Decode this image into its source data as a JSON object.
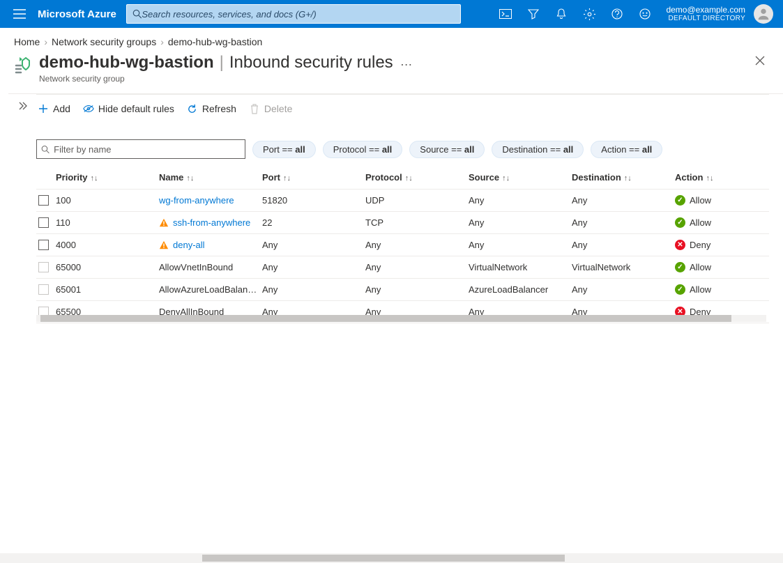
{
  "brand": "Microsoft Azure",
  "search": {
    "placeholder": "Search resources, services, and docs (G+/)"
  },
  "account": {
    "email": "demo@example.com",
    "directory": "DEFAULT DIRECTORY"
  },
  "breadcrumb": {
    "items": [
      {
        "label": "Home"
      },
      {
        "label": "Network security groups"
      },
      {
        "label": "demo-hub-wg-bastion"
      }
    ]
  },
  "page": {
    "resource_name": "demo-hub-wg-bastion",
    "section": "Inbound security rules",
    "subtitle": "Network security group"
  },
  "toolbar": {
    "add": "Add",
    "hide_default": "Hide default rules",
    "refresh": "Refresh",
    "delete": "Delete"
  },
  "filter": {
    "name_placeholder": "Filter by name",
    "pills": [
      {
        "prefix": "Port == ",
        "val": "all"
      },
      {
        "prefix": "Protocol == ",
        "val": "all"
      },
      {
        "prefix": "Source == ",
        "val": "all"
      },
      {
        "prefix": "Destination == ",
        "val": "all"
      },
      {
        "prefix": "Action == ",
        "val": "all"
      }
    ]
  },
  "columns": {
    "priority": "Priority",
    "name": "Name",
    "port": "Port",
    "protocol": "Protocol",
    "source": "Source",
    "destination": "Destination",
    "action": "Action"
  },
  "rows": [
    {
      "priority": "100",
      "name": "wg-from-anywhere",
      "link": true,
      "warn": false,
      "port": "51820",
      "protocol": "UDP",
      "source": "Any",
      "destination": "Any",
      "action": "Allow",
      "default_rule": false
    },
    {
      "priority": "110",
      "name": "ssh-from-anywhere",
      "link": true,
      "warn": true,
      "port": "22",
      "protocol": "TCP",
      "source": "Any",
      "destination": "Any",
      "action": "Allow",
      "default_rule": false
    },
    {
      "priority": "4000",
      "name": "deny-all",
      "link": true,
      "warn": true,
      "port": "Any",
      "protocol": "Any",
      "source": "Any",
      "destination": "Any",
      "action": "Deny",
      "default_rule": false
    },
    {
      "priority": "65000",
      "name": "AllowVnetInBound",
      "link": false,
      "warn": false,
      "port": "Any",
      "protocol": "Any",
      "source": "VirtualNetwork",
      "destination": "VirtualNetwork",
      "action": "Allow",
      "default_rule": true
    },
    {
      "priority": "65001",
      "name": "AllowAzureLoadBalan…",
      "link": false,
      "warn": false,
      "port": "Any",
      "protocol": "Any",
      "source": "AzureLoadBalancer",
      "destination": "Any",
      "action": "Allow",
      "default_rule": true
    },
    {
      "priority": "65500",
      "name": "DenyAllInBound",
      "link": false,
      "warn": false,
      "port": "Any",
      "protocol": "Any",
      "source": "Any",
      "destination": "Any",
      "action": "Deny",
      "default_rule": true
    }
  ]
}
